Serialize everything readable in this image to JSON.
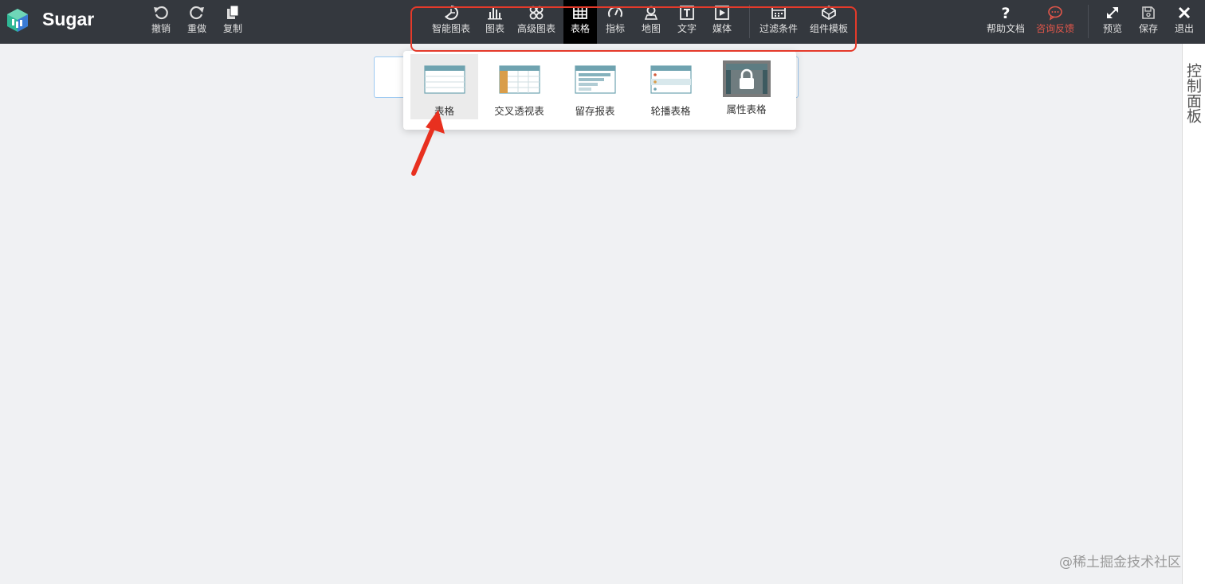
{
  "app": {
    "name": "Sugar"
  },
  "toolbar": {
    "left": [
      {
        "label": "撤销",
        "icon": "undo-icon"
      },
      {
        "label": "重做",
        "icon": "redo-icon"
      },
      {
        "label": "复制",
        "icon": "copy-icon"
      }
    ],
    "center": [
      {
        "label": "智能图表",
        "icon": "smart-chart-icon"
      },
      {
        "label": "图表",
        "icon": "bar-chart-icon"
      },
      {
        "label": "高级图表",
        "icon": "advanced-chart-icon"
      },
      {
        "label": "表格",
        "icon": "table-icon",
        "active": true
      },
      {
        "label": "指标",
        "icon": "gauge-icon"
      },
      {
        "label": "地图",
        "icon": "map-icon"
      },
      {
        "label": "文字",
        "icon": "text-icon"
      },
      {
        "label": "媒体",
        "icon": "media-icon"
      },
      {
        "label": "过滤条件",
        "icon": "filter-icon"
      },
      {
        "label": "组件模板",
        "icon": "template-icon"
      }
    ],
    "right": [
      {
        "label": "帮助文档",
        "icon": "help-icon"
      },
      {
        "label": "咨询反馈",
        "icon": "feedback-icon",
        "color": "#e0564a"
      },
      {
        "label": "预览",
        "icon": "expand-icon"
      },
      {
        "label": "保存",
        "icon": "save-icon"
      },
      {
        "label": "退出",
        "icon": "close-icon"
      }
    ]
  },
  "dropdown": {
    "items": [
      {
        "label": "表格",
        "icon": "basic-table-icon",
        "selected": true
      },
      {
        "label": "交叉透视表",
        "icon": "pivot-table-icon"
      },
      {
        "label": "留存报表",
        "icon": "retention-report-icon"
      },
      {
        "label": "轮播表格",
        "icon": "carousel-table-icon"
      },
      {
        "label": "属性表格",
        "icon": "locked-property-table-icon"
      }
    ]
  },
  "right_panel": {
    "label": "控制面板"
  },
  "watermark": "@稀土掘金技术社区",
  "colors": {
    "topbar": "#34383e",
    "active_tab": "#000000",
    "highlight_box": "#e53a2a",
    "arrow": "#e8301f",
    "logo_blue": "#3a7bd5",
    "logo_green": "#2fb896"
  }
}
